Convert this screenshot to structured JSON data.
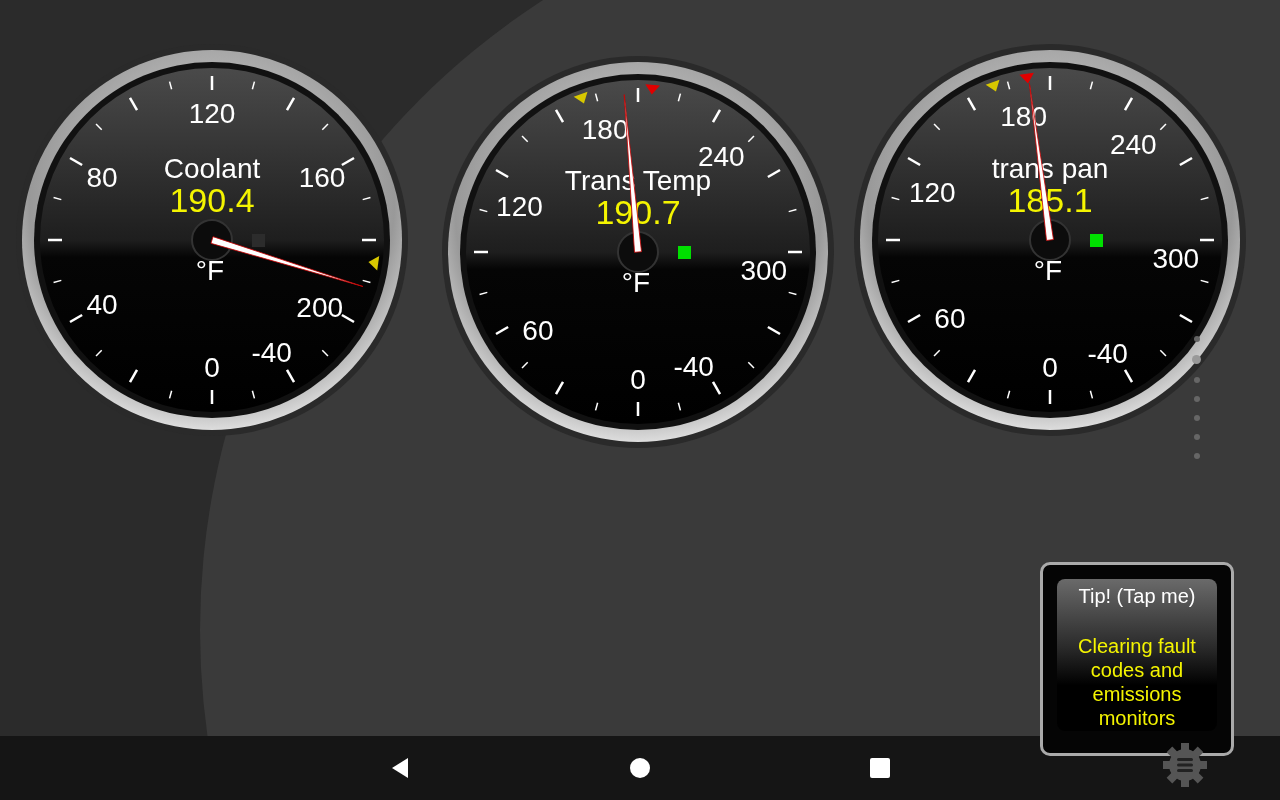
{
  "gauges": [
    {
      "name": "Coolant",
      "value": "190.4",
      "unit": "°F",
      "scale": [
        "120",
        "160",
        "200",
        "-40",
        "0",
        "40",
        "80"
      ],
      "indicator_on": false
    },
    {
      "name": "Trans Temp",
      "value": "190.7",
      "unit": "°F",
      "scale": [
        "180",
        "240",
        "300",
        "-40",
        "0",
        "60",
        "120"
      ],
      "indicator_on": true
    },
    {
      "name": "trans pan",
      "value": "185.1",
      "unit": "°F",
      "scale": [
        "180",
        "240",
        "300",
        "-40",
        "0",
        "60",
        "120"
      ],
      "indicator_on": true
    }
  ],
  "page_dots": [
    {
      "selected": false
    },
    {
      "selected": true
    },
    {
      "selected": false
    },
    {
      "selected": false
    },
    {
      "selected": false
    },
    {
      "selected": false
    },
    {
      "selected": false
    }
  ],
  "tip": {
    "title": "Tip! (Tap me)",
    "message": "Clearing fault codes and emissions monitors"
  }
}
